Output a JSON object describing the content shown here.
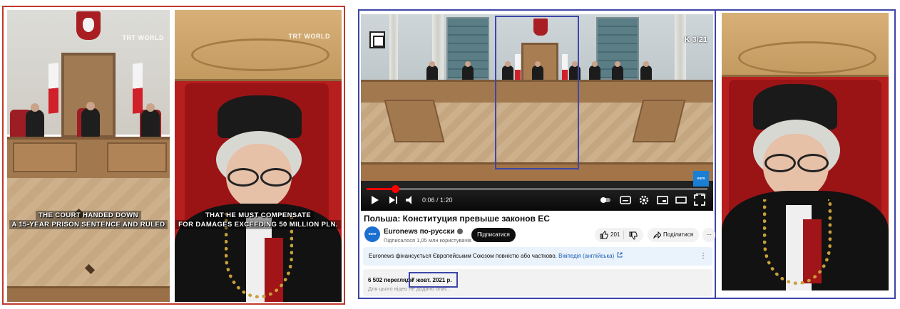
{
  "left_clip_1": {
    "watermark": "TRT WORLD",
    "subtitle_line1": "THE COURT HANDED DOWN",
    "subtitle_line2": "A 15-YEAR PRISON SENTENCE AND RULED"
  },
  "left_clip_2": {
    "watermark": "TRT WORLD",
    "subtitle_line1": "THAT HE MUST COMPENSATE",
    "subtitle_line2": "FOR DAMAGES EXCEEDING 50 MILLION PLN."
  },
  "video": {
    "counter": "K 3/21",
    "channel_badge": "euro news.",
    "progress_fraction": 0.083,
    "time": "0:06 / 1:20"
  },
  "meta": {
    "title": "Польша: Конституция превыше законов ЕС",
    "channel_avatar": "euro news.",
    "channel_name": "Euronews по-русски",
    "subscribers": "Підписалося 1,05 млн користувачів",
    "subscribe_label": "Підписатися",
    "likes": "201",
    "share_label": "Поділитися",
    "more_label": "···",
    "funding_text": "Euronews фінансується Європейським Союзом повністю або частково.",
    "funding_link": "Вікіпедія (англійська)",
    "views": "6 502 перегляди",
    "date": "7 жовт. 2021 р.",
    "description": "Для цього відео не додано опис."
  },
  "colors": {
    "red_frame": "#c0392b",
    "blue_frame": "#3d46a8",
    "progress": "#ff0000"
  }
}
